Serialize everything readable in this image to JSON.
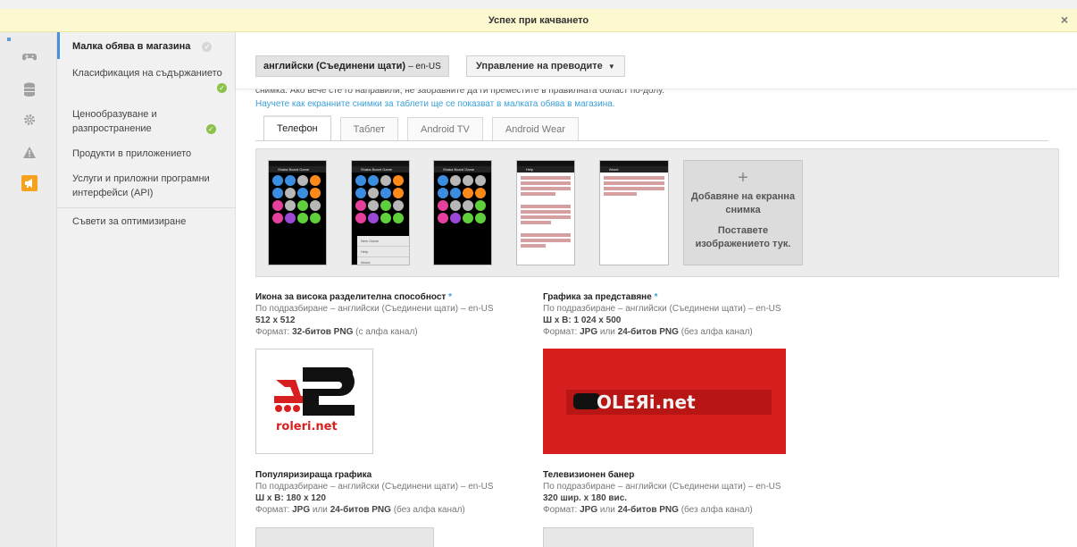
{
  "banner": {
    "message": "Успех при качването",
    "close": "×"
  },
  "rail": {
    "icons": [
      "gamepad-icon",
      "database-icon",
      "gear-icon",
      "warning-icon",
      "megaphone-icon"
    ]
  },
  "nav": {
    "items": [
      {
        "label": "Малка обява в магазина",
        "status": "grey"
      },
      {
        "label": "Класификация на съдържанието",
        "status": "ok"
      },
      {
        "label1": "Ценообразуване и",
        "label2": "разпространение",
        "status": "ok"
      },
      {
        "label": "Продукти в приложението"
      },
      {
        "label1": "Услуги и приложни програмни",
        "label2": "интерфейси (API)"
      },
      {
        "label": "Съвети за оптимизиране"
      }
    ]
  },
  "lang": {
    "name": "английски (Съединени щати)",
    "code": "– en-US",
    "manage": "Управление на преводите",
    "arrow": "▼"
  },
  "intro": {
    "cut": "снимка. Ако вече сте го направили, не забравяйте да ги преместите в правилната област по-долу.",
    "link": "Научете как екранните снимки за таблети ще се показват в малката обява в магазина."
  },
  "tabs": [
    "Телефон",
    "Таблет",
    "Android TV",
    "Android Wear"
  ],
  "screenshots": {
    "app_title": "Shaka Board Game",
    "help_title": "Help",
    "about_title": "About",
    "menu_items": [
      "New Game",
      "Help",
      "About"
    ],
    "add_label": "Добавяне на екранна снимка",
    "drop_label": "Поставете изображението тук.",
    "plus": "+"
  },
  "assets": {
    "hires_icon": {
      "title": "Икона за висока разделителна способност",
      "req": "*",
      "default": "По подразбиране – английски (Съединени щати) – en-US",
      "dims": "512 x 512",
      "format_prefix": "Формат:",
      "format_bold": "32-битов PNG",
      "format_suffix": "(с алфа канал)"
    },
    "feature": {
      "title": "Графика за представяне",
      "req": "*",
      "default": "По подразбиране – английски (Съединени щати) – en-US",
      "dims": "Ш х В: 1 024 x 500",
      "format_prefix": "Формат:",
      "format_bold1": "JPG",
      "format_mid": "или",
      "format_bold2": "24-битов PNG",
      "format_suffix": "(без алфа канал)"
    },
    "promo": {
      "title": "Популяризираща графика",
      "default": "По подразбиране – английски (Съединени щати) – en-US",
      "dims": "Ш х В: 180 x 120",
      "format_prefix": "Формат:",
      "format_bold1": "JPG",
      "format_mid": "или",
      "format_bold2": "24-битов PNG",
      "format_suffix": "(без алфа канал)"
    },
    "tv": {
      "title": "Телевизионен банер",
      "default": "По подразбиране – английски (Съединени щати) – en-US",
      "dims": "320 шир. x 180 вис.",
      "format_prefix": "Формат:",
      "format_bold1": "JPG",
      "format_mid": "или",
      "format_bold2": "24-битов PNG",
      "format_suffix": "(без алфа канал)"
    }
  },
  "logo": {
    "icon_text": "roleri.net",
    "feature_text": "OLEЯi.net"
  },
  "colors": {
    "banner_bg": "#fcf8cf",
    "link": "#3aa0d9",
    "check": "#8cc24a",
    "feature_bg": "#d81f1f",
    "active_rail": "#f5a21d"
  }
}
